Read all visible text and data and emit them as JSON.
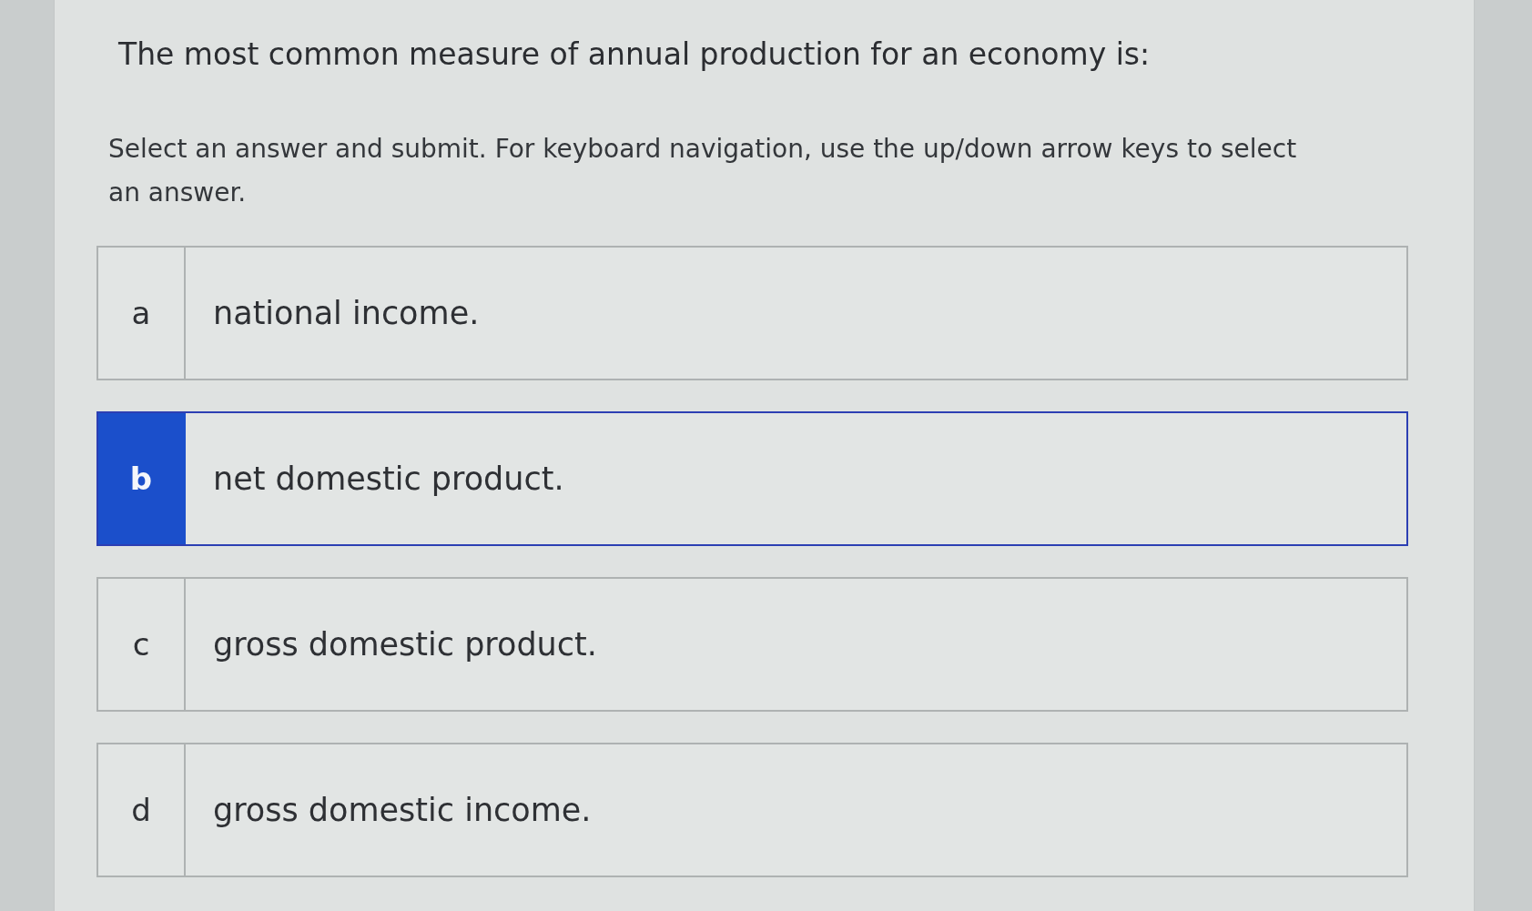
{
  "question": "The most common measure of annual production for an economy is:",
  "instructions": "Select an answer and submit. For keyboard navigation, use the up/down arrow keys to select an answer.",
  "options": [
    {
      "letter": "a",
      "text": "national income.",
      "selected": false
    },
    {
      "letter": "b",
      "text": "net domestic product.",
      "selected": true
    },
    {
      "letter": "c",
      "text": "gross domestic product.",
      "selected": false
    },
    {
      "letter": "d",
      "text": "gross domestic income.",
      "selected": false
    }
  ]
}
